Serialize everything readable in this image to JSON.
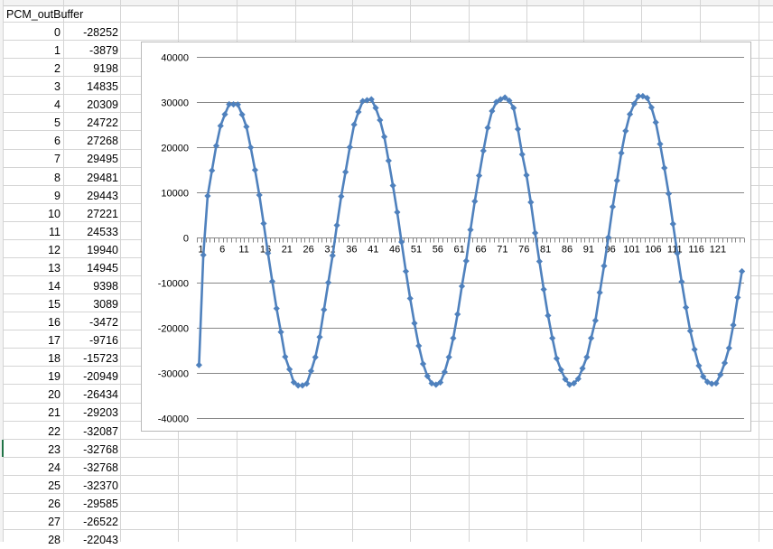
{
  "sheet": {
    "header_label": "PCM_outBuffer",
    "rows": [
      {
        "idx": "0",
        "val": "-28252"
      },
      {
        "idx": "1",
        "val": "-3879"
      },
      {
        "idx": "2",
        "val": "9198"
      },
      {
        "idx": "3",
        "val": "14835"
      },
      {
        "idx": "4",
        "val": "20309"
      },
      {
        "idx": "5",
        "val": "24722"
      },
      {
        "idx": "6",
        "val": "27268"
      },
      {
        "idx": "7",
        "val": "29495"
      },
      {
        "idx": "8",
        "val": "29481"
      },
      {
        "idx": "9",
        "val": "29443"
      },
      {
        "idx": "10",
        "val": "27221"
      },
      {
        "idx": "11",
        "val": "24533"
      },
      {
        "idx": "12",
        "val": "19940"
      },
      {
        "idx": "13",
        "val": "14945"
      },
      {
        "idx": "14",
        "val": "9398"
      },
      {
        "idx": "15",
        "val": "3089"
      },
      {
        "idx": "16",
        "val": "-3472"
      },
      {
        "idx": "17",
        "val": "-9716"
      },
      {
        "idx": "18",
        "val": "-15723"
      },
      {
        "idx": "19",
        "val": "-20949"
      },
      {
        "idx": "20",
        "val": "-26434"
      },
      {
        "idx": "21",
        "val": "-29203"
      },
      {
        "idx": "22",
        "val": "-32087"
      },
      {
        "idx": "23",
        "val": "-32768"
      },
      {
        "idx": "24",
        "val": "-32768"
      },
      {
        "idx": "25",
        "val": "-32370"
      },
      {
        "idx": "26",
        "val": "-29585"
      },
      {
        "idx": "27",
        "val": "-26522"
      },
      {
        "idx": "28",
        "val": "-22043"
      }
    ]
  },
  "chart_data": {
    "type": "line",
    "title": "",
    "xlabel": "",
    "ylabel": "",
    "grid": true,
    "legend": "none",
    "marker": "diamond",
    "color": "#4f81bd",
    "ylim": [
      -40000,
      40000
    ],
    "y_ticks": [
      "40000",
      "30000",
      "20000",
      "10000",
      "0",
      "-10000",
      "-20000",
      "-30000",
      "-40000"
    ],
    "x_tick_labels": [
      "1",
      "6",
      "11",
      "16",
      "21",
      "26",
      "31",
      "36",
      "41",
      "46",
      "51",
      "56",
      "61",
      "66",
      "71",
      "76",
      "81",
      "86",
      "91",
      "96",
      "101",
      "106",
      "111",
      "116",
      "121"
    ],
    "x": [
      1,
      2,
      3,
      4,
      5,
      6,
      7,
      8,
      9,
      10,
      11,
      12,
      13,
      14,
      15,
      16,
      17,
      18,
      19,
      20,
      21,
      22,
      23,
      24,
      25,
      26,
      27,
      28,
      29,
      30,
      31,
      32,
      33,
      34,
      35,
      36,
      37,
      38,
      39,
      40,
      41,
      42,
      43,
      44,
      45,
      46,
      47,
      48,
      49,
      50,
      51,
      52,
      53,
      54,
      55,
      56,
      57,
      58,
      59,
      60,
      61,
      62,
      63,
      64,
      65,
      66,
      67,
      68,
      69,
      70,
      71,
      72,
      73,
      74,
      75,
      76,
      77,
      78,
      79,
      80,
      81,
      82,
      83,
      84,
      85,
      86,
      87,
      88,
      89,
      90,
      91,
      92,
      93,
      94,
      95,
      96,
      97,
      98,
      99,
      100,
      101,
      102,
      103,
      104,
      105,
      106,
      107,
      108,
      109,
      110,
      111,
      112,
      113,
      114,
      115,
      116,
      117,
      118,
      119,
      120,
      121,
      122,
      123,
      124,
      125
    ],
    "values": [
      -28252,
      -3879,
      9198,
      14835,
      20309,
      24722,
      27268,
      29495,
      29481,
      29443,
      27221,
      24533,
      19940,
      14945,
      9398,
      3089,
      -3472,
      -9716,
      -15723,
      -20949,
      -26434,
      -29203,
      -32087,
      -32768,
      -32768,
      -32370,
      -29585,
      -26522,
      -22043,
      -16000,
      -10000,
      -4000,
      2700,
      9100,
      14500,
      20000,
      25000,
      27800,
      30200,
      30400,
      30600,
      28700,
      26000,
      22300,
      17000,
      11500,
      5600,
      -1000,
      -7500,
      -13500,
      -19000,
      -24000,
      -28000,
      -30700,
      -32300,
      -32600,
      -32100,
      -29800,
      -26500,
      -22300,
      -17000,
      -10800,
      -5200,
      1700,
      8000,
      13700,
      19200,
      24300,
      28000,
      30000,
      30600,
      31000,
      30300,
      28700,
      24000,
      18400,
      13800,
      7800,
      1000,
      -5300,
      -11500,
      -17300,
      -22300,
      -26800,
      -29300,
      -31400,
      -32600,
      -32300,
      -31300,
      -29000,
      -26500,
      -22300,
      -18400,
      -12200,
      -6300,
      0,
      6800,
      12600,
      18700,
      23600,
      27300,
      29600,
      31300,
      31300,
      30900,
      28800,
      25500,
      20700,
      15400,
      9700,
      3000,
      -3500,
      -9800,
      -15500,
      -20700,
      -24800,
      -28400,
      -30800,
      -32000,
      -32400,
      -32300,
      -30400,
      -27800,
      -24500,
      -19400,
      -13300,
      -7500
    ]
  }
}
